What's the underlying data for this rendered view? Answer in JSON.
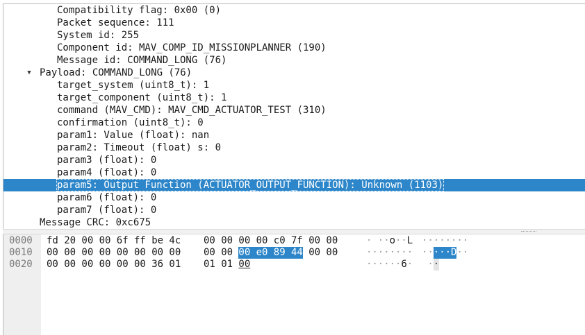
{
  "tree": {
    "rows": [
      {
        "text": "Compatibility flag: 0x00 (0)",
        "indent": 2
      },
      {
        "text": "Packet sequence: 111",
        "indent": 2
      },
      {
        "text": "System id: 255",
        "indent": 2
      },
      {
        "text": "Component id: MAV_COMP_ID_MISSIONPLANNER (190)",
        "indent": 2
      },
      {
        "text": "Message id: COMMAND_LONG (76)",
        "indent": 2
      },
      {
        "text": "Payload: COMMAND_LONG (76)",
        "indent": 1,
        "expanded": true
      },
      {
        "text": "target_system (uint8_t): 1",
        "indent": 2
      },
      {
        "text": "target_component (uint8_t): 1",
        "indent": 2
      },
      {
        "text": "command (MAV_CMD): MAV_CMD_ACTUATOR_TEST (310)",
        "indent": 2
      },
      {
        "text": "confirmation (uint8_t): 0",
        "indent": 2
      },
      {
        "text": "param1: Value (float): nan",
        "indent": 2
      },
      {
        "text": "param2: Timeout (float) s: 0",
        "indent": 2
      },
      {
        "text": "param3 (float): 0",
        "indent": 2
      },
      {
        "text": "param4 (float): 0",
        "indent": 2
      },
      {
        "text": "param5: Output Function (ACTUATOR_OUTPUT_FUNCTION): Unknown (1103)",
        "indent": 2,
        "selected": true
      },
      {
        "text": "param6 (float): 0",
        "indent": 2
      },
      {
        "text": "param7 (float): 0",
        "indent": 2
      },
      {
        "text": "Message CRC: 0xc675",
        "indent": 1
      }
    ]
  },
  "hex": {
    "rows": [
      {
        "offset": "0000",
        "bytes": [
          "fd",
          "20",
          "00",
          "00",
          "6f",
          "ff",
          "be",
          "4c",
          "00",
          "00",
          "00",
          "00",
          "c0",
          "7f",
          "00",
          "00"
        ],
        "ascii": [
          "·",
          " ",
          "·",
          "·",
          "o",
          "·",
          "·",
          "L",
          "·",
          "·",
          "·",
          "·",
          "·",
          "·",
          "·",
          "·"
        ]
      },
      {
        "offset": "0010",
        "bytes": [
          "00",
          "00",
          "00",
          "00",
          "00",
          "00",
          "00",
          "00",
          "00",
          "00",
          "00",
          "e0",
          "89",
          "44",
          "00",
          "00"
        ],
        "ascii": [
          "·",
          "·",
          "·",
          "·",
          "·",
          "·",
          "·",
          "·",
          "·",
          "·",
          "·",
          "·",
          "·",
          "D",
          "·",
          "·"
        ],
        "highlight": [
          10,
          11,
          12,
          13
        ]
      },
      {
        "offset": "0020",
        "bytes": [
          "00",
          "00",
          "00",
          "00",
          "00",
          "00",
          "36",
          "01",
          "01",
          "01",
          "00"
        ],
        "ascii": [
          "·",
          "·",
          "·",
          "·",
          "·",
          "·",
          "6",
          "·",
          " ",
          "·",
          "·"
        ],
        "underline": [
          10
        ]
      }
    ]
  }
}
